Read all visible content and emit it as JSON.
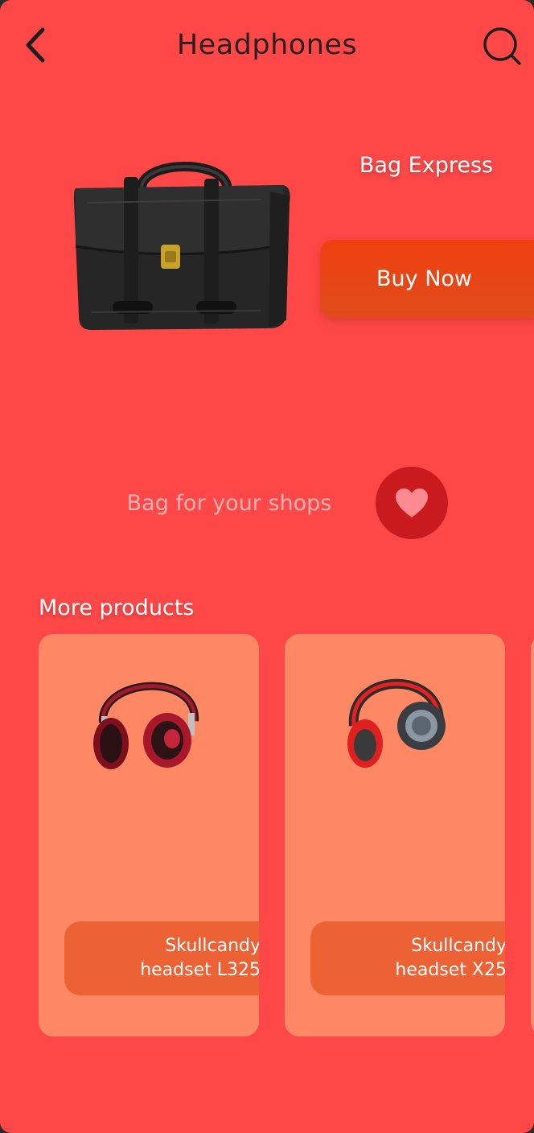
{
  "header": {
    "title": "Headphones",
    "back_icon": "chevron-left-icon",
    "search_icon": "search-icon"
  },
  "hero": {
    "product_name": "Bag Express",
    "buy_label": "Buy Now",
    "tagline": "Bag for your shops",
    "favorite_icon": "heart-icon"
  },
  "more": {
    "title": "More products",
    "products": [
      {
        "name_line1": "Skullcandy",
        "name_line2": "headset L325"
      },
      {
        "name_line1": "Skullcandy",
        "name_line2": "headset X25"
      }
    ]
  },
  "colors": {
    "background": "#fe4848",
    "buy_button": "#ef3f10",
    "favorite_button": "#c91a1f",
    "card": "#fe8863",
    "card_label": "#ec6235"
  }
}
